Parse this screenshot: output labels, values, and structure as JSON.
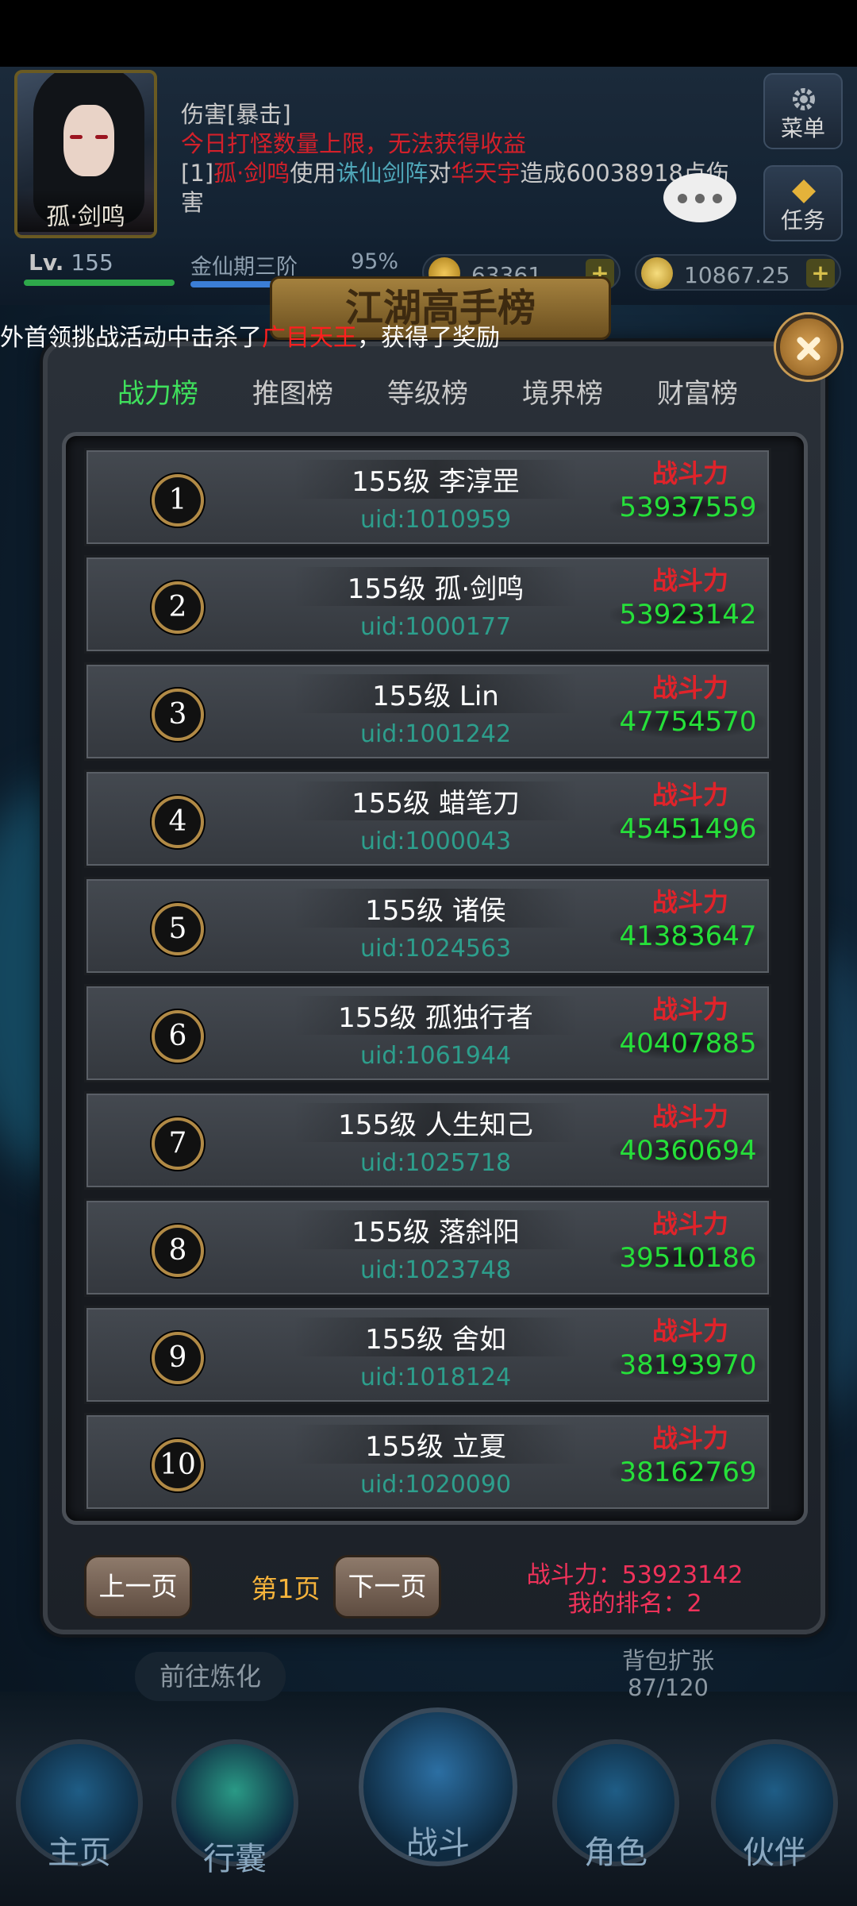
{
  "player": {
    "name": "孤·剑鸣",
    "level_prefix": "Lv.",
    "level": "155",
    "realm": "金仙期三阶",
    "realm_progress": "95%",
    "ingots": "63361",
    "gold": "10867.25"
  },
  "chat": {
    "line1": "伤害[暴击]",
    "line2": "今日打怪数量上限，无法获得收益",
    "line3_prefix": "[1]",
    "line3_player": "孤·剑鸣",
    "line3_use": "使用",
    "line3_skill": "诛仙剑阵",
    "line3_to": "对",
    "line3_target": "华天宇",
    "line3_damage": "造成60038918",
    "line3_suffix": "点伤",
    "line4": "害"
  },
  "side_buttons": {
    "menu": "菜单",
    "task": "任务"
  },
  "broadcast": {
    "prefix": "外首领挑战活动中击杀了",
    "boss": "广目天王",
    "suffix": "，获得了奖励"
  },
  "panel": {
    "title": "江湖高手榜",
    "tabs": [
      "战力榜",
      "推图榜",
      "等级榜",
      "境界榜",
      "财富榜"
    ],
    "active_tab": 0,
    "power_label": "战斗力",
    "rows": [
      {
        "rank": "1",
        "name": "155级 李淳罡",
        "uid": "uid:1010959",
        "power": "53937559"
      },
      {
        "rank": "2",
        "name": "155级 孤·剑鸣",
        "uid": "uid:1000177",
        "power": "53923142"
      },
      {
        "rank": "3",
        "name": "155级 Lin",
        "uid": "uid:1001242",
        "power": "47754570"
      },
      {
        "rank": "4",
        "name": "155级 蜡笔刀",
        "uid": "uid:1000043",
        "power": "45451496"
      },
      {
        "rank": "5",
        "name": "155级 诸侯",
        "uid": "uid:1024563",
        "power": "41383647"
      },
      {
        "rank": "6",
        "name": "155级 孤独行者",
        "uid": "uid:1061944",
        "power": "40407885"
      },
      {
        "rank": "7",
        "name": "155级 人生知己",
        "uid": "uid:1025718",
        "power": "40360694"
      },
      {
        "rank": "8",
        "name": "155级 落斜阳",
        "uid": "uid:1023748",
        "power": "39510186"
      },
      {
        "rank": "9",
        "name": "155级 舍如",
        "uid": "uid:1018124",
        "power": "38193970"
      },
      {
        "rank": "10",
        "name": "155级 立夏",
        "uid": "uid:1020090",
        "power": "38162769"
      }
    ],
    "prev_page": "上一页",
    "page": "第1页",
    "next_page": "下一页",
    "my_power": "战斗力：53923142",
    "my_rank": "我的排名：2"
  },
  "below_panel": {
    "refine": "前往炼化",
    "bag_label": "背包扩张",
    "bag_count": "87/120"
  },
  "bottom_nav": [
    "主页",
    "行囊",
    "战斗",
    "角色",
    "伙伴"
  ],
  "colors": {
    "active_tab": "#3fe05c",
    "power_value": "#26e03a",
    "power_label": "#e0232a",
    "uid": "#2d9e8c",
    "page": "#f5b33b"
  }
}
